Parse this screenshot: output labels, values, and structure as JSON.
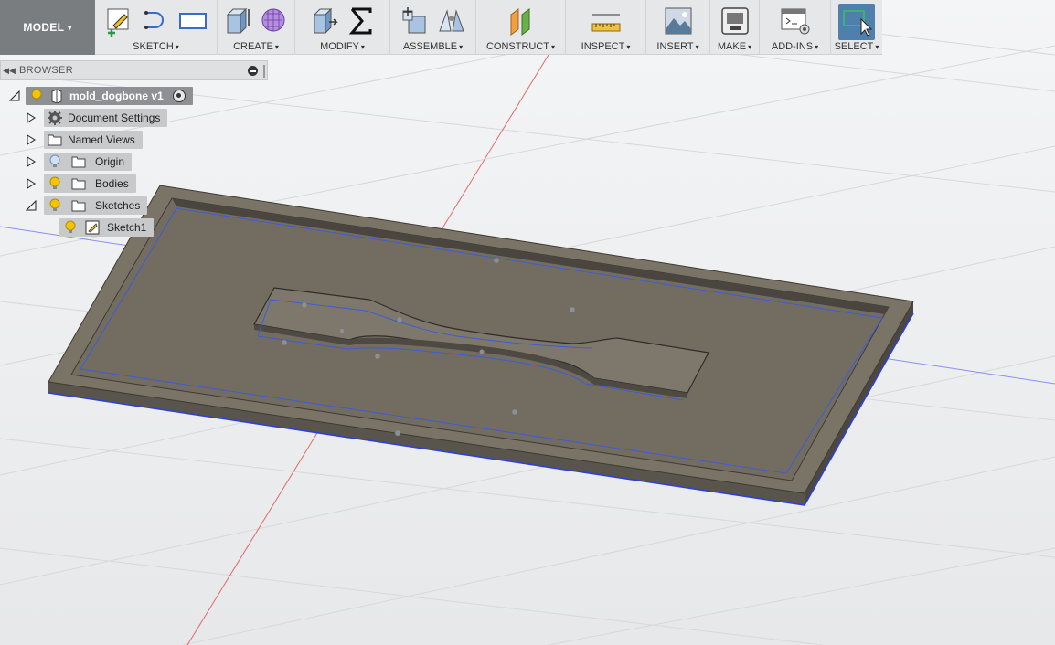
{
  "toolbar": {
    "model_label": "MODEL",
    "groups": [
      {
        "label": "SKETCH"
      },
      {
        "label": "CREATE"
      },
      {
        "label": "MODIFY"
      },
      {
        "label": "ASSEMBLE"
      },
      {
        "label": "CONSTRUCT"
      },
      {
        "label": "INSPECT"
      },
      {
        "label": "INSERT"
      },
      {
        "label": "MAKE"
      },
      {
        "label": "ADD-INS"
      },
      {
        "label": "SELECT"
      }
    ],
    "caret": "▾"
  },
  "browser": {
    "title": "BROWSER",
    "root": {
      "label": "mold_dogbone v1"
    },
    "items": [
      {
        "label": "Document Settings",
        "icon": "gear-icon"
      },
      {
        "label": "Named Views",
        "icon": "folder-icon"
      },
      {
        "label": "Origin",
        "icon": "folder-icon"
      },
      {
        "label": "Bodies",
        "icon": "folder-icon"
      },
      {
        "label": "Sketches",
        "icon": "folder-icon"
      },
      {
        "label": "Sketch1",
        "icon": "sketch-icon"
      }
    ]
  },
  "colors": {
    "selected_tool": "#4f7fad",
    "model_button": "#7a7d80",
    "body_fill": "#7a7467",
    "sketch_line": "#3d5bd6"
  }
}
